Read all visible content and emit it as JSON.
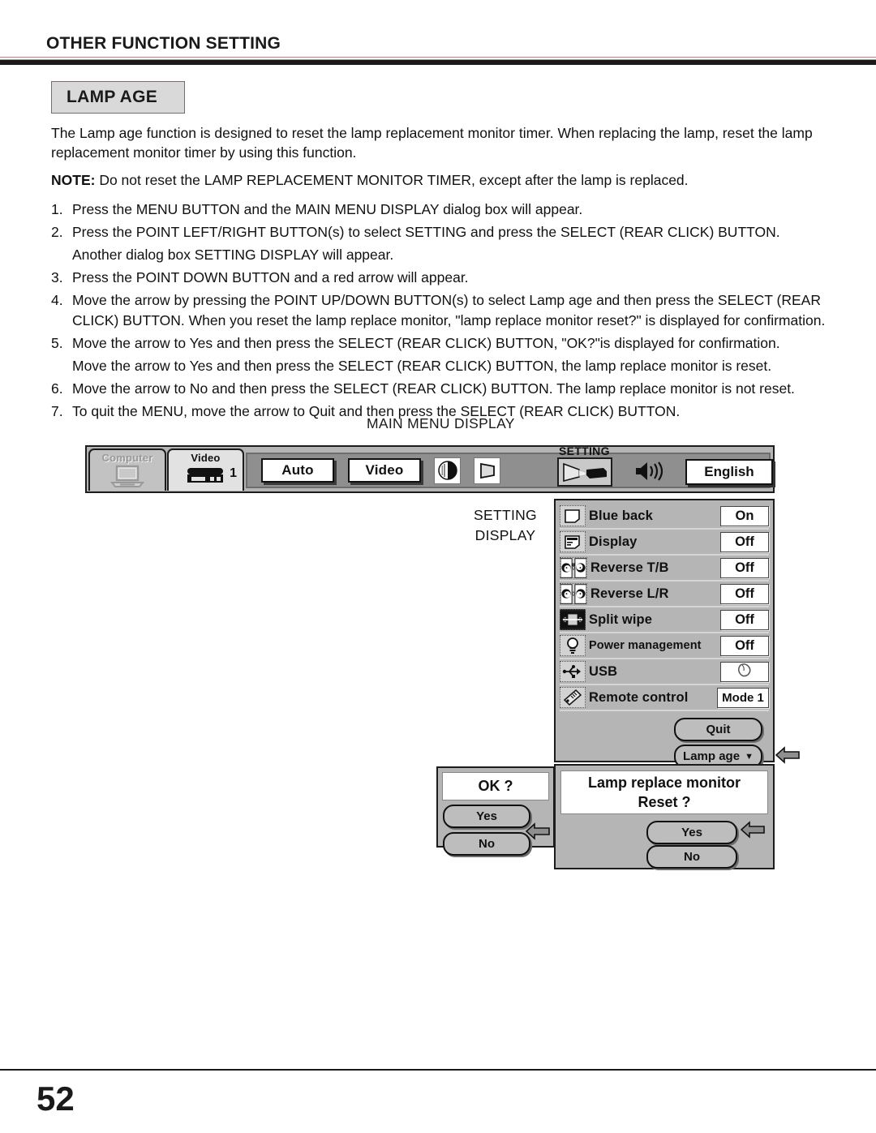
{
  "header": {
    "title": "OTHER FUNCTION SETTING",
    "section_badge": "LAMP AGE"
  },
  "body": {
    "intro": "The Lamp age function is designed to reset the lamp replacement monitor timer. When replacing the lamp, reset the lamp replacement monitor timer by using this function.",
    "note_label": "NOTE:",
    "note_text": "Do not reset the LAMP REPLACEMENT MONITOR TIMER, except after the lamp is replaced.",
    "steps": [
      {
        "num": "1.",
        "text": "Press the MENU BUTTON and the MAIN MENU DISPLAY dialog box will appear."
      },
      {
        "num": "2.",
        "text": "Press the POINT LEFT/RIGHT BUTTON(s) to select SETTING and press the SELECT (REAR CLICK) BUTTON."
      },
      {
        "num": "3.",
        "text": "Press the POINT DOWN BUTTON and a red arrow will appear."
      },
      {
        "num": "4.",
        "text": "Move the arrow by pressing the POINT UP/DOWN BUTTON(s) to select Lamp age and then press the SELECT (REAR CLICK) BUTTON. When you reset the lamp replace monitor, \"lamp replace monitor reset?\" is displayed for confirmation."
      },
      {
        "num": "5.",
        "text": "Move the arrow to Yes and then press the SELECT (REAR CLICK) BUTTON, \"OK?\"is displayed for confirmation."
      },
      {
        "num": "6.",
        "text": "Move the arrow to No and then press the SELECT (REAR CLICK) BUTTON. The lamp replace monitor is not reset."
      },
      {
        "num": "7.",
        "text": "To quit the MENU, move the arrow to Quit and then press the SELECT (REAR CLICK) BUTTON."
      }
    ],
    "substep_after_2": "Another dialog box SETTING DISPLAY will appear.",
    "substep_after_5": "Move the arrow to Yes and then press the SELECT (REAR CLICK) BUTTON, the lamp replace monitor is reset."
  },
  "diagram": {
    "main_menu_label": "MAIN MENU DISPLAY",
    "setting_display_label_line1": "SETTING",
    "setting_display_label_line2": "DISPLAY",
    "menubar": {
      "tabs": [
        {
          "label": "Computer",
          "icon": "laptop-icon",
          "active": false
        },
        {
          "label": "Video",
          "icon": "vcr-icon",
          "badge": "1",
          "active": true
        }
      ],
      "buttons": [
        {
          "label": "Auto"
        },
        {
          "label": "Video"
        }
      ],
      "icon_buttons": [
        "contrast-icon",
        "keystone-icon"
      ],
      "setting_group": {
        "title": "SETTING",
        "icon": "projector-icon",
        "speaker_icon": "speaker-icon",
        "language_value": "English"
      }
    },
    "settings_panel": {
      "rows": [
        {
          "icon": "blue-back-icon",
          "label": "Blue back",
          "value": "On"
        },
        {
          "icon": "display-icon",
          "label": "Display",
          "value": "Off"
        },
        {
          "icon": "reverse-tb-icon",
          "label": "Reverse T/B",
          "value": "Off"
        },
        {
          "icon": "reverse-lr-icon",
          "label": "Reverse L/R",
          "value": "Off"
        },
        {
          "icon": "split-wipe-icon",
          "label": "Split wipe",
          "value": "Off"
        },
        {
          "icon": "power-management-icon",
          "label": "Power management",
          "value": "Off"
        },
        {
          "icon": "usb-icon",
          "label": "USB",
          "value": "mouse-icon"
        },
        {
          "icon": "remote-control-icon",
          "label": "Remote control",
          "value": "Mode 1"
        }
      ],
      "quit_label": "Quit",
      "lamp_age_label": "Lamp age",
      "pointer_icon": "left-arrow-icon"
    },
    "ok_dialog": {
      "message": "OK ?",
      "yes_label": "Yes",
      "no_label": "No",
      "pointer_icon": "left-arrow-icon"
    },
    "lamp_dialog": {
      "message_line1": "Lamp replace monitor",
      "message_line2": "Reset ?",
      "yes_label": "Yes",
      "no_label": "No",
      "pointer_icon": "left-arrow-icon"
    }
  },
  "footer": {
    "page_number": "52"
  },
  "colors": {
    "rule": "#1a1a1a",
    "badge_bg": "#d9d9d9",
    "panel_bg": "#b5b5b5",
    "menubar_inner": "#8f8f8f",
    "value_bg": "#ffffff"
  }
}
